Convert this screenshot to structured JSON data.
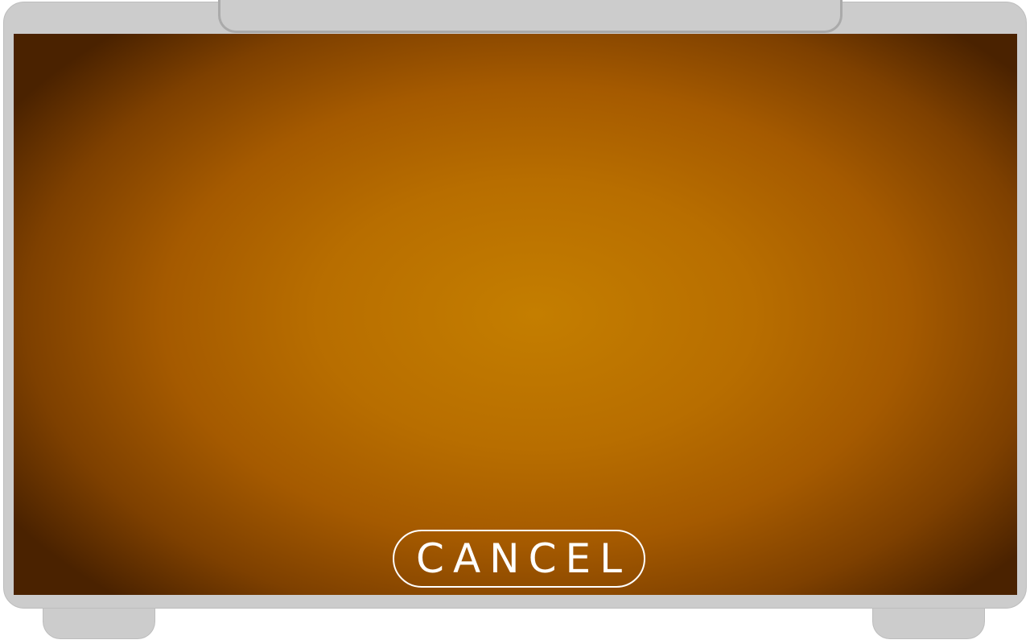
{
  "screen": {
    "cancel_label": "CANCEL"
  },
  "colors": {
    "frame": "#cccccc",
    "frame_border": "#bdbdbd",
    "screen_center": "#c47e00",
    "screen_edge": "#4a2200",
    "button_text": "#ffffff"
  }
}
